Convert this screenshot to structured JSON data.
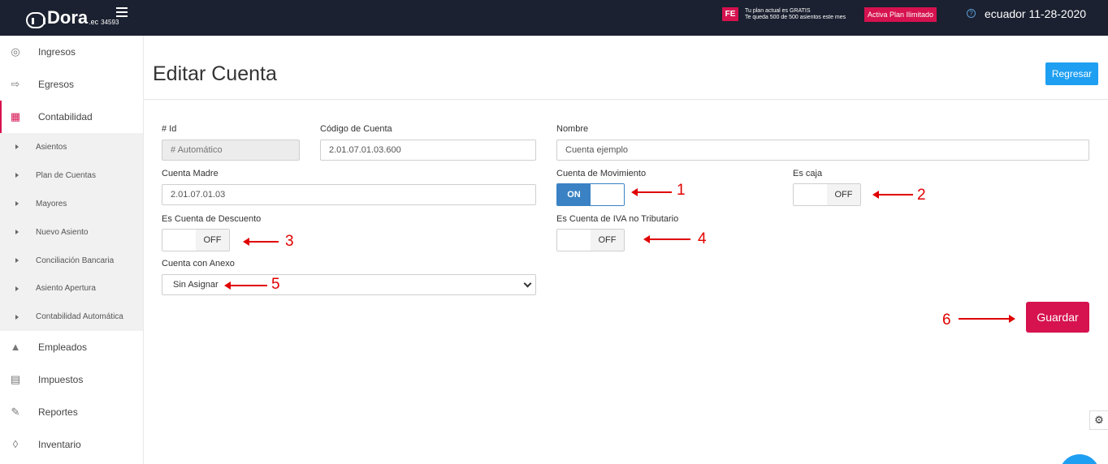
{
  "header": {
    "logo_text": "Dora",
    "logo_suffix": ".ec",
    "account_number": "34593",
    "fe_badge": "FE",
    "plan_line1": "Tu plan actual es GRATIS",
    "plan_line2": "Te queda 500 de 500 asientos este mes",
    "plan_button": "Activa Plan Ilimitado",
    "user_date": "ecuador 11-28-2020"
  },
  "sidebar": {
    "items": [
      {
        "label": "Ingresos",
        "icon": "piggy-bank-icon"
      },
      {
        "label": "Egresos",
        "icon": "money-out-icon"
      },
      {
        "label": "Contabilidad",
        "icon": "calculator-icon"
      }
    ],
    "submenu": [
      {
        "label": "Asientos"
      },
      {
        "label": "Plan de Cuentas"
      },
      {
        "label": "Mayores"
      },
      {
        "label": "Nuevo Asiento"
      },
      {
        "label": "Conciliación Bancaria"
      },
      {
        "label": "Asiento Apertura"
      },
      {
        "label": "Contabilidad Automática"
      }
    ],
    "items_after": [
      {
        "label": "Empleados",
        "icon": "org-chart-icon"
      },
      {
        "label": "Impuestos",
        "icon": "tax-icon"
      },
      {
        "label": "Reportes",
        "icon": "report-icon"
      },
      {
        "label": "Inventario",
        "icon": "boxes-icon"
      }
    ]
  },
  "main": {
    "title": "Editar Cuenta",
    "back_button": "Regresar",
    "save_button": "Guardar"
  },
  "form": {
    "id_label": "# Id",
    "id_placeholder": "# Automático",
    "code_label": "Código de Cuenta",
    "code_value": "2.01.07.01.03.600",
    "name_label": "Nombre",
    "name_value": "Cuenta ejemplo",
    "parent_label": "Cuenta Madre",
    "parent_value": "2.01.07.01.03",
    "movement_label": "Cuenta de Movimiento",
    "movement_state": "ON",
    "cash_label": "Es caja",
    "cash_state": "OFF",
    "discount_label": "Es Cuenta de Descuento",
    "discount_state": "OFF",
    "iva_label": "Es Cuenta de IVA no Tributario",
    "iva_state": "OFF",
    "annex_label": "Cuenta con Anexo",
    "annex_value": "Sin Asignar"
  },
  "annotations": {
    "n1": "1",
    "n2": "2",
    "n3": "3",
    "n4": "4",
    "n5": "5",
    "n6": "6",
    "color": "#e00000"
  },
  "colors": {
    "topbar": "#1b2130",
    "accent": "#d6124f",
    "primary": "#1e9ff2",
    "toggle_on": "#3a82c4"
  }
}
